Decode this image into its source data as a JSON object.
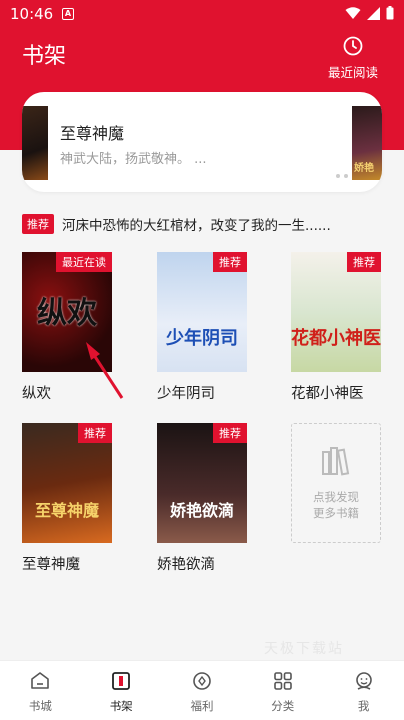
{
  "status_bar": {
    "time": "10:46",
    "badge": "A"
  },
  "header": {
    "title": "书架",
    "recent_label": "最近阅读"
  },
  "banner": {
    "book_title": "至尊神魔",
    "description": "神武大陆，扬武敬神。 ...",
    "right_cover_text": "娇艳"
  },
  "notice": {
    "tag": "推荐",
    "text": "河床中恐怖的大红棺材，改变了我的一生......"
  },
  "books": [
    {
      "name": "纵欢",
      "badge": "最近在读",
      "cover_text": "纵欢"
    },
    {
      "name": "少年阴司",
      "badge": "推荐",
      "cover_text": "少年阴司"
    },
    {
      "name": "花都小神医",
      "badge": "推荐",
      "cover_text": "花都小神医"
    },
    {
      "name": "至尊神魔",
      "badge": "推荐",
      "cover_text": "至尊神魔"
    },
    {
      "name": "娇艳欲滴",
      "badge": "推荐",
      "cover_text": "娇艳欲滴"
    }
  ],
  "discover": {
    "line1": "点我发现",
    "line2": "更多书籍"
  },
  "watermark": "天极下载站",
  "tabs": [
    {
      "label": "书城",
      "icon": "home-icon"
    },
    {
      "label": "书架",
      "icon": "bookshelf-icon"
    },
    {
      "label": "福利",
      "icon": "diamond-icon"
    },
    {
      "label": "分类",
      "icon": "grid-icon"
    },
    {
      "label": "我",
      "icon": "profile-icon"
    }
  ],
  "colors": {
    "accent": "#e0122f"
  }
}
